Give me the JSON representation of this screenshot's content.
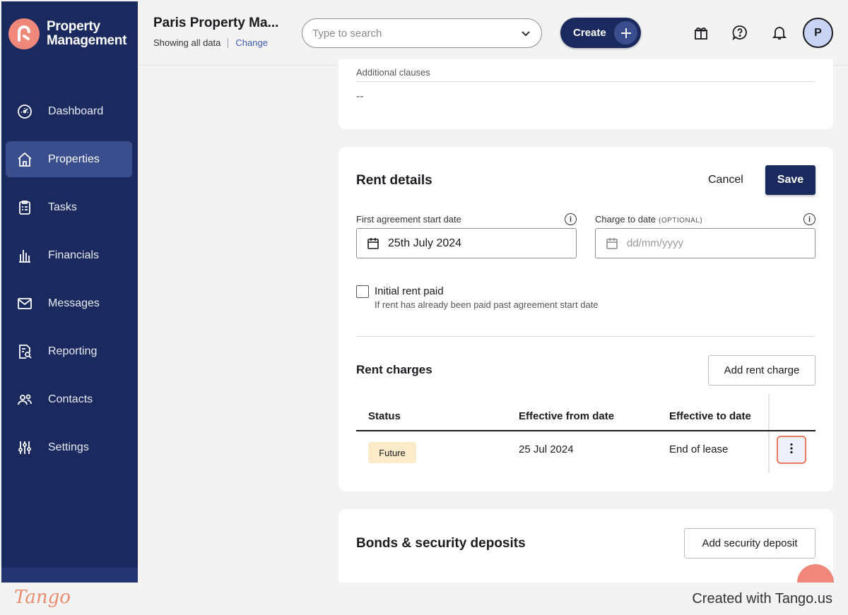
{
  "app": {
    "brand_line1": "Property",
    "brand_line2": "Management"
  },
  "sidebar": {
    "items": [
      {
        "label": "Dashboard",
        "icon": "dashboard-icon"
      },
      {
        "label": "Properties",
        "icon": "home-icon",
        "active": true
      },
      {
        "label": "Tasks",
        "icon": "clipboard-icon"
      },
      {
        "label": "Financials",
        "icon": "bank-icon"
      },
      {
        "label": "Messages",
        "icon": "mail-icon"
      },
      {
        "label": "Reporting",
        "icon": "report-icon"
      },
      {
        "label": "Contacts",
        "icon": "contacts-icon"
      },
      {
        "label": "Settings",
        "icon": "sliders-icon"
      }
    ]
  },
  "header": {
    "account_title": "Paris Property Ma...",
    "showing": "Showing all data",
    "change": "Change",
    "search_placeholder": "Type to search",
    "create_label": "Create",
    "avatar_initial": "P"
  },
  "clauses": {
    "label": "Additional clauses",
    "value": "--"
  },
  "rent_details": {
    "title": "Rent details",
    "cancel_label": "Cancel",
    "save_label": "Save",
    "start_date_label": "First agreement start date",
    "start_date_value": "25th July 2024",
    "charge_to_label": "Charge to date",
    "charge_to_optional": "(OPTIONAL)",
    "charge_to_placeholder": "dd/mm/yyyy",
    "initial_rent_label": "Initial rent paid",
    "initial_rent_help": "If rent has already been paid past agreement start date",
    "initial_rent_checked": false
  },
  "rent_charges": {
    "title": "Rent charges",
    "add_label": "Add rent charge",
    "columns": [
      "Status",
      "Effective from date",
      "Effective to date"
    ],
    "rows": [
      {
        "status": "Future",
        "from": "25 Jul 2024",
        "to": "End of lease"
      }
    ]
  },
  "bonds": {
    "title": "Bonds & security deposits",
    "add_label": "Add security deposit"
  },
  "footer": {
    "logo": "Tango",
    "text": "Created with Tango.us"
  },
  "colors": {
    "sidebar": "#1b2a5e",
    "accent": "#f0877b",
    "highlight": "#e57b5a",
    "badge_future": "#fcebc9"
  }
}
